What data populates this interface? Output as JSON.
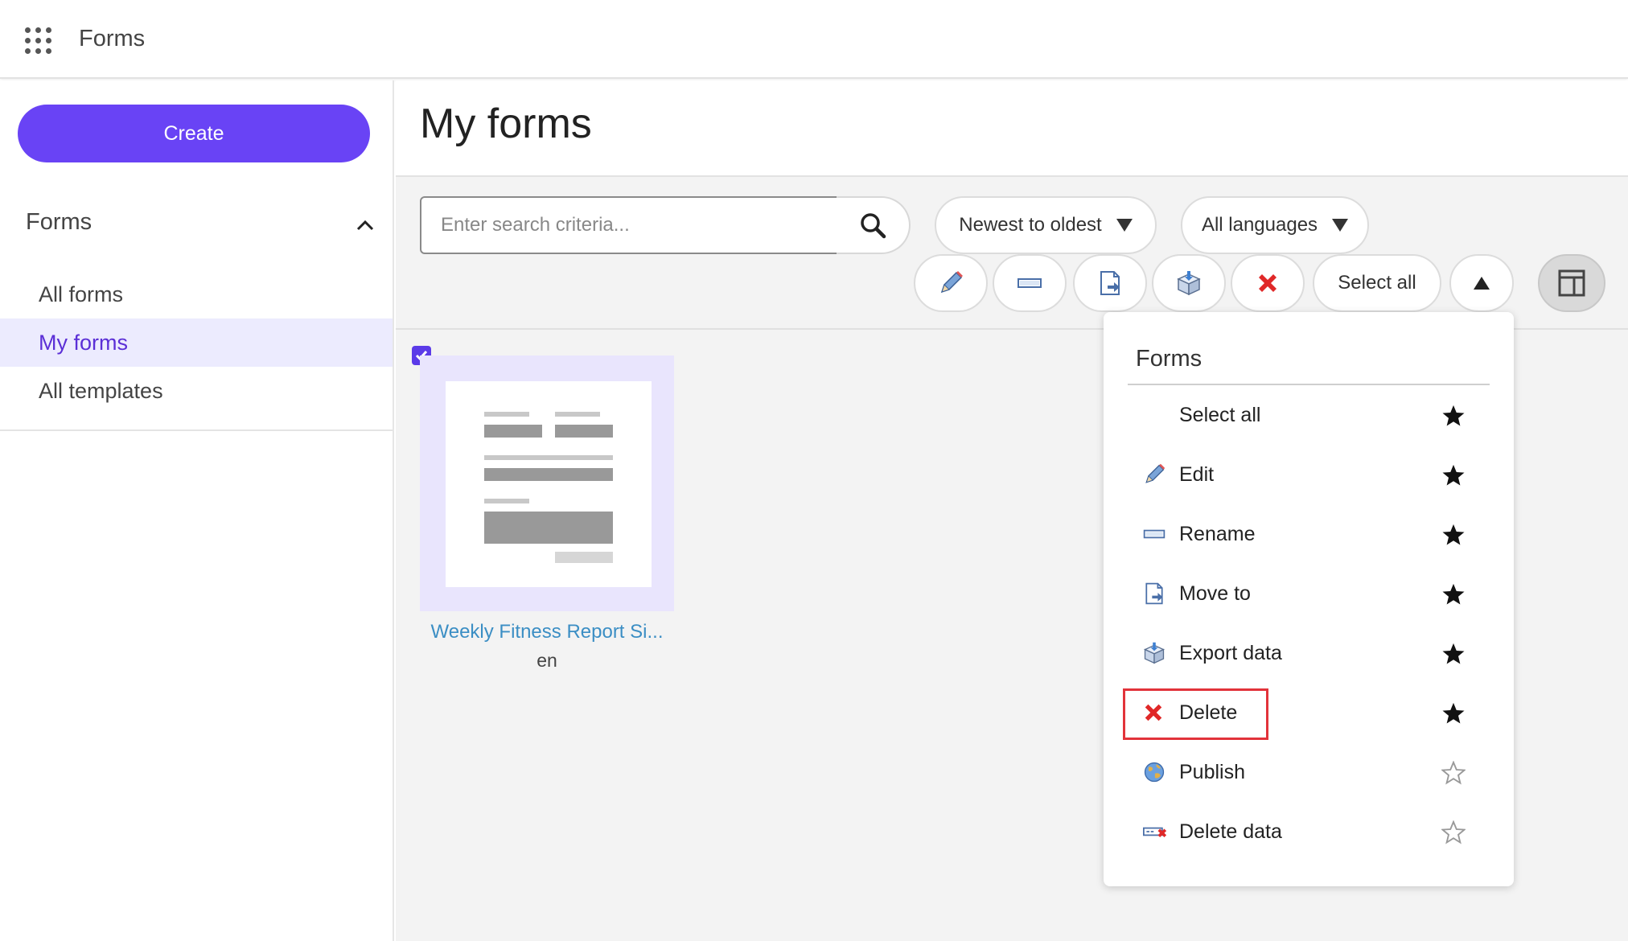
{
  "app": {
    "title": "Forms"
  },
  "sidebar": {
    "create_label": "Create",
    "section_title": "Forms",
    "items": [
      {
        "label": "All forms",
        "active": false
      },
      {
        "label": "My forms",
        "active": true
      },
      {
        "label": "All templates",
        "active": false
      }
    ]
  },
  "main": {
    "page_title": "My forms",
    "search": {
      "placeholder": "Enter search criteria...",
      "value": ""
    },
    "sort": {
      "selected": "Newest to oldest"
    },
    "language": {
      "selected": "All languages"
    },
    "toolbar": {
      "select_all_label": "Select all"
    }
  },
  "form_card": {
    "title": "Weekly Fitness Report Si...",
    "language": "en",
    "selected": true
  },
  "menu": {
    "header": "Forms",
    "items": [
      {
        "label": "Select all",
        "icon": "none",
        "starred": true
      },
      {
        "label": "Edit",
        "icon": "pencil-icon",
        "starred": true
      },
      {
        "label": "Rename",
        "icon": "rename-icon",
        "starred": true
      },
      {
        "label": "Move to",
        "icon": "move-to-icon",
        "starred": true
      },
      {
        "label": "Export data",
        "icon": "export-data-icon",
        "starred": true
      },
      {
        "label": "Delete",
        "icon": "delete-icon",
        "starred": true,
        "highlighted": true
      },
      {
        "label": "Publish",
        "icon": "publish-icon",
        "starred": false
      },
      {
        "label": "Delete data",
        "icon": "delete-data-icon",
        "starred": false
      }
    ]
  },
  "colors": {
    "accent": "#6943f5",
    "active_nav_bg": "#ecebfe",
    "active_nav_text": "#5b2fd6",
    "highlight": "#e2333a",
    "link": "#3b8ec4"
  }
}
